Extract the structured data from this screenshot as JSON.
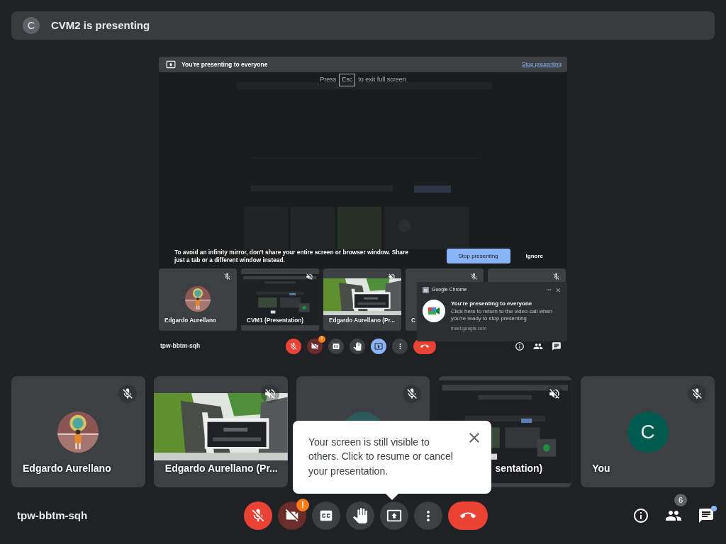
{
  "banner": {
    "avatar": "C",
    "text": "CVM2 is presenting"
  },
  "shared_screen": {
    "top_bar": {
      "text": "You're presenting to everyone",
      "action": "Stop presenting"
    },
    "fullscreen_hint": {
      "prefix": "Press",
      "key": "Esc",
      "suffix": "to exit full screen"
    },
    "warning": {
      "text": "To avoid an infinity mirror, don't share your entire screen or browser window. Share just a tab or a different window instead.",
      "primary": "Stop presenting",
      "secondary": "Ignore"
    },
    "tiles": [
      {
        "kind": "photo_avatar",
        "name": "Edgardo Aurellano",
        "mic_muted": true
      },
      {
        "kind": "picture",
        "name": "CVM1 (Presentation)",
        "volume_muted": true
      },
      {
        "kind": "picture",
        "name": "Edgardo Aurellano (Pr...",
        "volume_muted": true
      },
      {
        "kind": "blank",
        "name": "C",
        "mic_muted": true
      },
      {
        "kind": "blank",
        "mic_muted": true
      }
    ],
    "meeting_code": "tpw-bbtm-sqh",
    "controls": [
      {
        "kind": "mic",
        "on": false
      },
      {
        "kind": "camera",
        "on": false,
        "alert": "!"
      },
      {
        "kind": "captions",
        "on": false
      },
      {
        "kind": "hand",
        "on": false
      },
      {
        "kind": "present",
        "on": true
      },
      {
        "kind": "more"
      },
      {
        "kind": "leave"
      }
    ],
    "side_buttons": [
      {
        "kind": "info"
      },
      {
        "kind": "people"
      },
      {
        "kind": "chat"
      }
    ],
    "notification": {
      "app": "Google Chrome",
      "title": "You're presenting to everyone",
      "body": "Click here to return to the video call when you're ready to stop presenting",
      "source": "meet.google.com"
    }
  },
  "tiles": [
    {
      "kind": "photo_avatar",
      "name": "Edgardo Aurellano",
      "mic_muted": true
    },
    {
      "kind": "picture",
      "name": "Edgardo Aurellano (Pr...",
      "volume_muted": true
    },
    {
      "kind": "letter_avatar",
      "mic_muted": true
    },
    {
      "kind": "picture",
      "name": "sentation)",
      "volume_muted": true,
      "partly_covered": true
    },
    {
      "kind": "letter_avatar",
      "letter": "C",
      "name": "You",
      "mic_muted": true
    }
  ],
  "popup": {
    "text": "Your screen is still visible to others. Click to resume or cancel your presentation."
  },
  "meeting_code": "tpw-bbtm-sqh",
  "controls": [
    {
      "kind": "mic",
      "on": false
    },
    {
      "kind": "camera",
      "on": false,
      "alert": "!"
    },
    {
      "kind": "captions",
      "on": false
    },
    {
      "kind": "hand",
      "on": false
    },
    {
      "kind": "present",
      "on": false
    },
    {
      "kind": "more"
    },
    {
      "kind": "leave"
    }
  ],
  "side_buttons": [
    {
      "kind": "info"
    },
    {
      "kind": "people",
      "badge": "6"
    },
    {
      "kind": "chat",
      "unread": true
    }
  ]
}
